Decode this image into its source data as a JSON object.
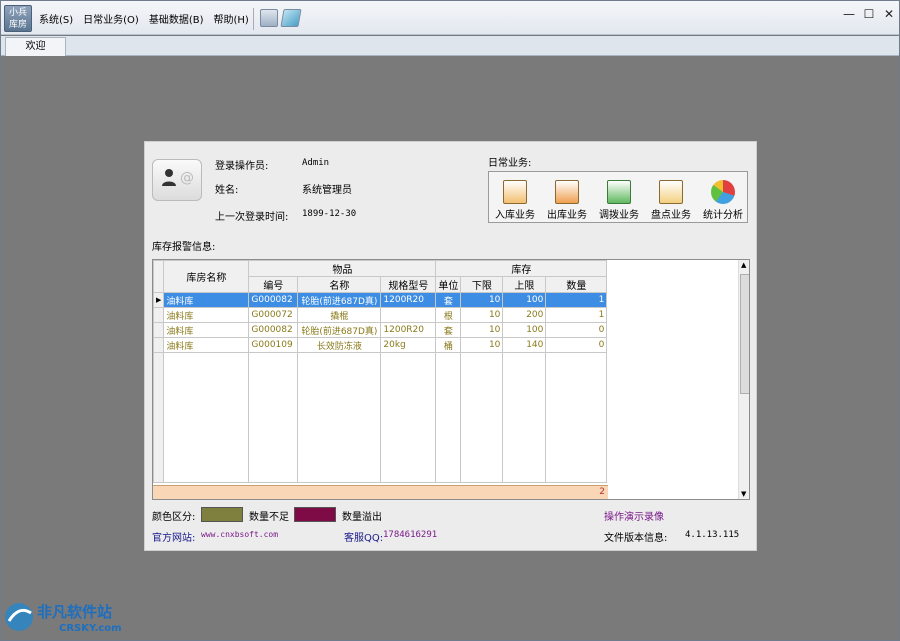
{
  "app": {
    "logo_text": "小兵\n库房"
  },
  "menu": [
    "系统(S)",
    "日常业务(O)",
    "基础数据(B)",
    "帮助(H)"
  ],
  "window_controls": {
    "minimize": "—",
    "restore": "☐",
    "close": "✕"
  },
  "tabs": [
    {
      "label": "欢迎"
    }
  ],
  "login": {
    "operator_label": "登录操作员:",
    "operator_value": "Admin",
    "name_label": "姓名:",
    "name_value": "系统管理员",
    "last_login_label": "上一次登录时间:",
    "last_login_value": "1899-12-30"
  },
  "daily": {
    "title": "日常业务:",
    "buttons": [
      {
        "label": "入库业务",
        "icon": "inbound-icon"
      },
      {
        "label": "出库业务",
        "icon": "outbound-icon"
      },
      {
        "label": "调拨业务",
        "icon": "transfer-icon"
      },
      {
        "label": "盘点业务",
        "icon": "inventory-check-icon"
      },
      {
        "label": "统计分析",
        "icon": "pie-chart-icon"
      }
    ]
  },
  "alarm": {
    "title": "库存报警信息:",
    "headers": {
      "warehouse": "库房名称",
      "goods": "物品",
      "stock": "库存",
      "code": "编号",
      "name": "名称",
      "spec": "规格型号",
      "unit": "单位",
      "low": "下限",
      "high": "上限",
      "qty": "数量"
    },
    "rows": [
      {
        "warehouse": "油料库",
        "code": "G000082",
        "name": "轮胎(前进687D真)",
        "spec": "1200R20",
        "unit": "套",
        "low": "10",
        "high": "100",
        "qty": "1"
      },
      {
        "warehouse": "油料库",
        "code": "G000072",
        "name": "撬棍",
        "spec": "",
        "unit": "根",
        "low": "10",
        "high": "200",
        "qty": "1"
      },
      {
        "warehouse": "油料库",
        "code": "G000082",
        "name": "轮胎(前进687D真)",
        "spec": "1200R20",
        "unit": "套",
        "low": "10",
        "high": "100",
        "qty": "0"
      },
      {
        "warehouse": "油料库",
        "code": "G000109",
        "name": "长效防冻液",
        "spec": "20kg",
        "unit": "桶",
        "low": "10",
        "high": "140",
        "qty": "0"
      }
    ],
    "total": "2"
  },
  "legend": {
    "label": "颜色区分:",
    "short_label": "数量不足",
    "short_color": "#7f7f3e",
    "over_label": "数量溢出",
    "over_color": "#7e0a46",
    "demo_link": "操作演示录像"
  },
  "footer": {
    "site_label": "官方网站:",
    "site_value": "www.cnxbsoft.com",
    "qq_label": "客服QQ:",
    "qq_value": "1784616291",
    "version_label": "文件版本信息:",
    "version_value": "4.1.13.115"
  },
  "watermark": {
    "text": "非凡软件站",
    "sub": "CRSKY.com"
  }
}
